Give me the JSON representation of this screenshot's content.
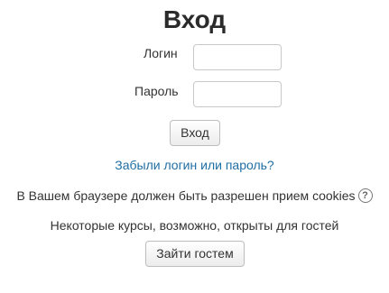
{
  "title": "Вход",
  "form": {
    "login_label": "Логин",
    "login_value": "",
    "password_label": "Пароль",
    "password_value": "",
    "submit_label": "Вход"
  },
  "forgot_link": "Забыли логин или пароль?",
  "cookies_notice": "В Вашем браузере должен быть разрешен прием cookies",
  "help_icon": "question-circle-icon",
  "guests_notice": "Некоторые курсы, возможно, открыты для гостей",
  "guest_button_label": "Зайти гостем",
  "colors": {
    "link": "#1f6ea3",
    "text": "#333333",
    "title": "#2b2b2b"
  }
}
